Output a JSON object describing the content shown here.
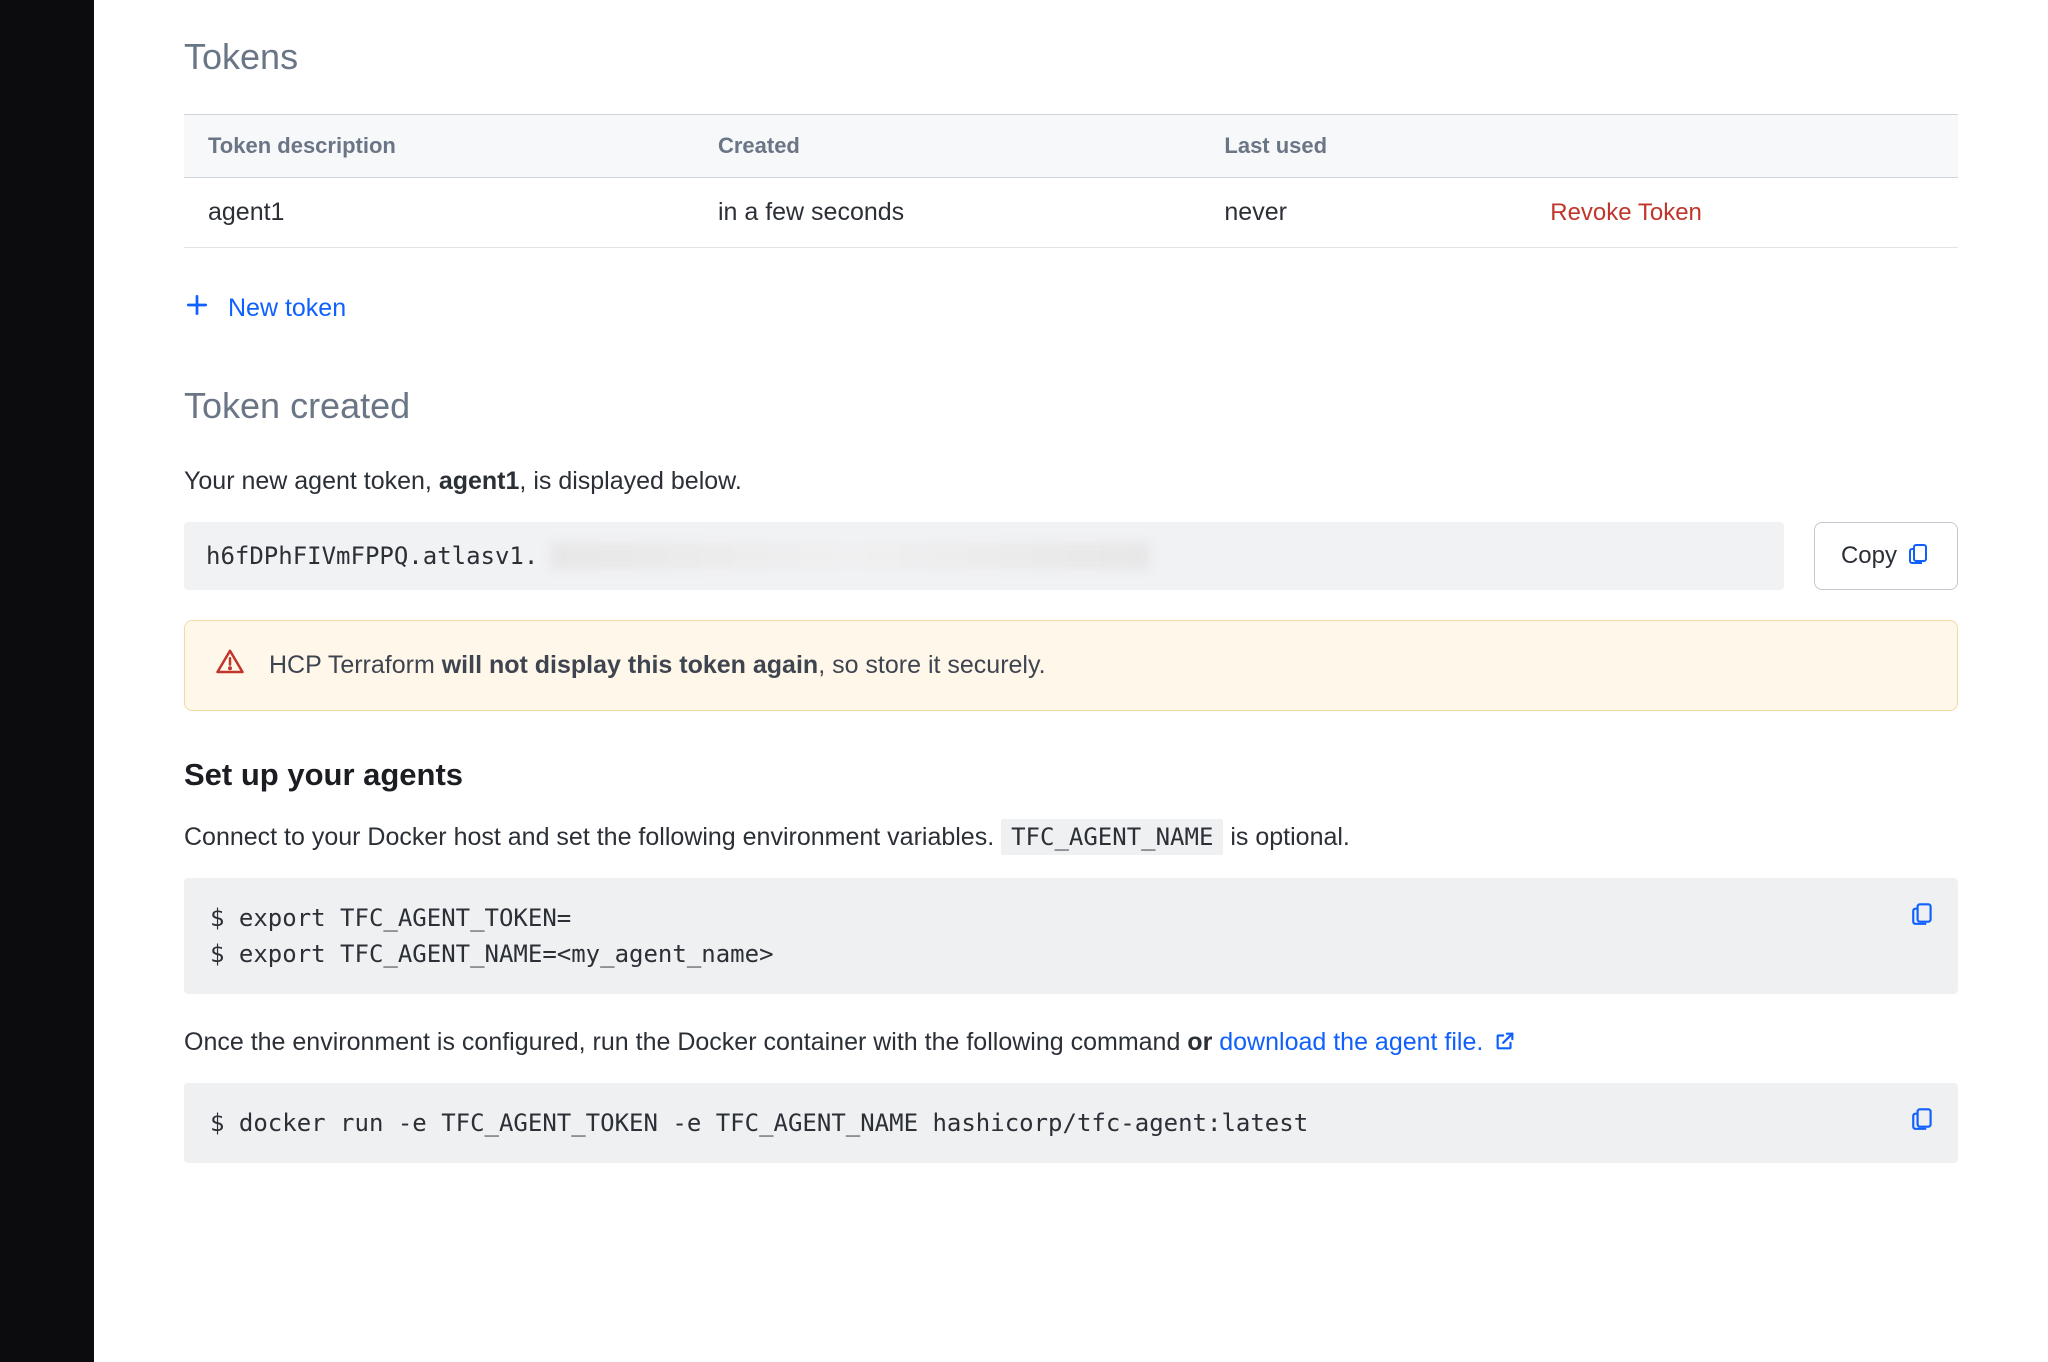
{
  "tokens_section": {
    "title": "Tokens",
    "headers": {
      "desc": "Token description",
      "created": "Created",
      "last_used": "Last used"
    },
    "rows": [
      {
        "desc": "agent1",
        "created": "in a few seconds",
        "last_used": "never",
        "revoke": "Revoke Token"
      }
    ],
    "new_token": "New token"
  },
  "token_created": {
    "title": "Token created",
    "intro_pre": "Your new agent token, ",
    "intro_name": "agent1",
    "intro_post": ", is displayed below.",
    "token_prefix": "h6fDPhFIVmFPPQ.atlasv1.",
    "copy": "Copy",
    "warning_pre": "HCP Terraform ",
    "warning_strong": "will not display this token again",
    "warning_post": ", so store it securely."
  },
  "setup": {
    "title": "Set up your agents",
    "para1_pre": "Connect to your Docker host and set the following environment variables. ",
    "para1_code": "TFC_AGENT_NAME",
    "para1_post": " is optional.",
    "code1": "$ export TFC_AGENT_TOKEN=\n$ export TFC_AGENT_NAME=<my_agent_name>",
    "para2_pre": "Once the environment is configured, run the Docker container with the following command ",
    "para2_or": "or",
    "para2_link": " download the agent file.",
    "code2": "$ docker run -e TFC_AGENT_TOKEN -e TFC_AGENT_NAME hashicorp/tfc-agent:latest"
  }
}
